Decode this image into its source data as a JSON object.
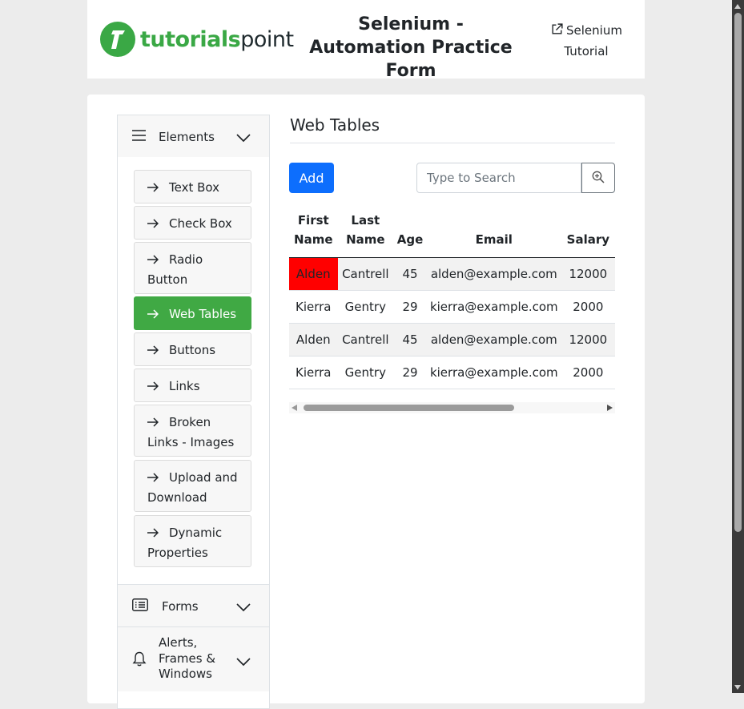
{
  "header": {
    "logo_text_bold": "tutorials",
    "logo_text_light": "point",
    "title": "Selenium - Automation Practice Form",
    "tutorial_link": "Selenium Tutorial"
  },
  "sidebar": {
    "sections": [
      {
        "label": "Elements",
        "icon": "menu-icon",
        "expanded": true
      },
      {
        "label": "Forms",
        "icon": "list-icon",
        "expanded": false
      },
      {
        "label": "Alerts, Frames & Windows",
        "icon": "bell-icon",
        "expanded": false
      }
    ],
    "items": [
      {
        "label": "Text Box",
        "active": false
      },
      {
        "label": "Check Box",
        "active": false
      },
      {
        "label": "Radio Button",
        "active": false
      },
      {
        "label": "Web Tables",
        "active": true
      },
      {
        "label": "Buttons",
        "active": false
      },
      {
        "label": "Links",
        "active": false
      },
      {
        "label": "Broken Links - Images",
        "active": false
      },
      {
        "label": "Upload and Download",
        "active": false
      },
      {
        "label": "Dynamic Properties",
        "active": false
      }
    ]
  },
  "main": {
    "title": "Web Tables",
    "add_label": "Add",
    "search_placeholder": "Type to Search",
    "table": {
      "headers": [
        "First Name",
        "Last Name",
        "Age",
        "Email",
        "Salary"
      ],
      "rows": [
        [
          "Alden",
          "Cantrell",
          "45",
          "alden@example.com",
          "12000"
        ],
        [
          "Kierra",
          "Gentry",
          "29",
          "kierra@example.com",
          "2000"
        ],
        [
          "Alden",
          "Cantrell",
          "45",
          "alden@example.com",
          "12000"
        ],
        [
          "Kierra",
          "Gentry",
          "29",
          "kierra@example.com",
          "2000"
        ]
      ]
    }
  },
  "colors": {
    "brand_green": "#3aa845",
    "active_item": "#40a944",
    "primary_button": "#0d6efd",
    "highlight_cell": "#ff0000"
  }
}
